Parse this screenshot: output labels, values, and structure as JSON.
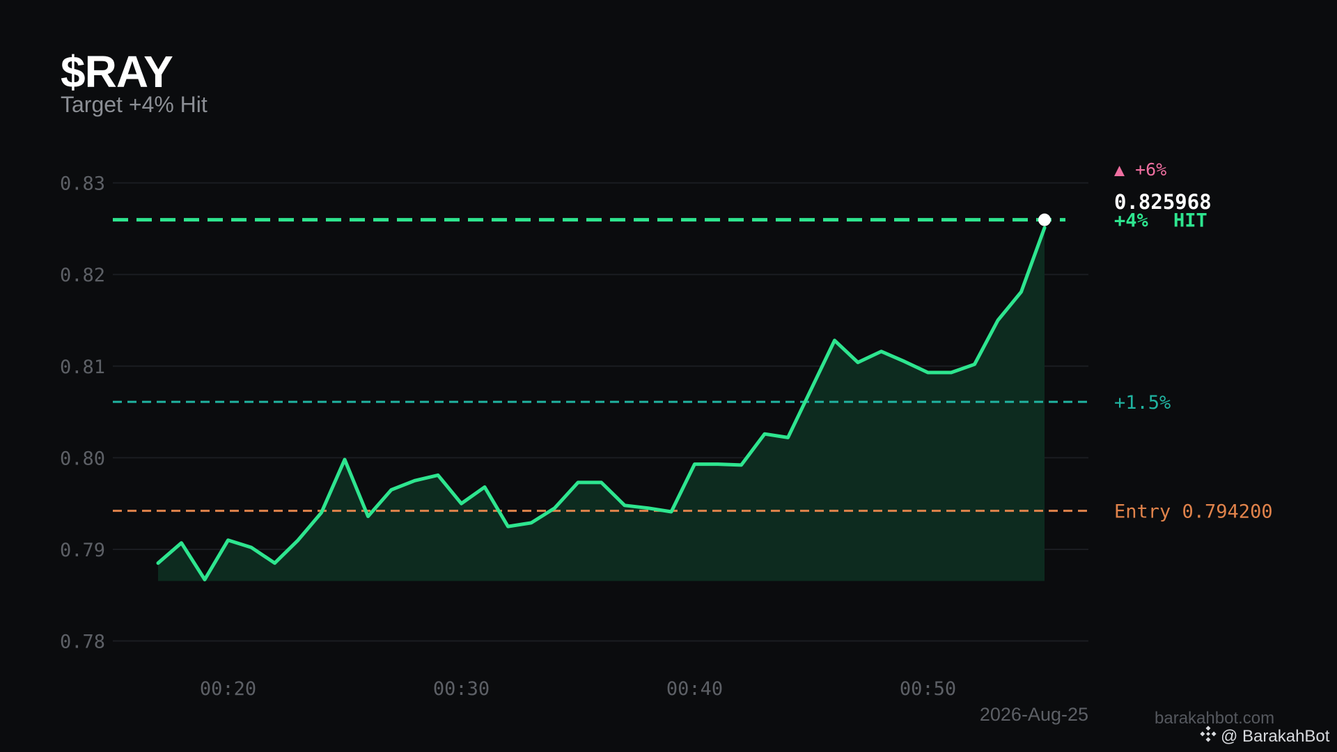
{
  "header": {
    "ticker": "$RAY",
    "subtitle": "Target +4% Hit"
  },
  "footer": {
    "date": "2026-Aug-25",
    "site": "barakahbot.com",
    "handle": "@ BarakahBot"
  },
  "colors": {
    "background": "#0b0c0e",
    "price_line": "#2ee58f",
    "area_fill": "#0d2b1f",
    "target_hit": "#2ee58f",
    "level_1_5": "#20b3a0",
    "entry": "#e0834b",
    "level_6": "#ef6fa0",
    "grid": "#1b1d21",
    "tick_text": "#5d6066"
  },
  "chart_data": {
    "type": "area",
    "ylim": [
      0.777,
      0.834
    ],
    "y_ticks": [
      0.78,
      0.79,
      0.8,
      0.81,
      0.82,
      0.83
    ],
    "y_tick_labels": [
      "0.78",
      "0.79",
      "0.80",
      "0.81",
      "0.82",
      "0.83"
    ],
    "x_ticks": [
      "00:20",
      "00:30",
      "00:40",
      "00:50"
    ],
    "x": [
      "00:17",
      "00:18",
      "00:19",
      "00:20",
      "00:21",
      "00:22",
      "00:23",
      "00:24",
      "00:25",
      "00:26",
      "00:27",
      "00:28",
      "00:29",
      "00:30",
      "00:31",
      "00:32",
      "00:33",
      "00:34",
      "00:35",
      "00:36",
      "00:37",
      "00:38",
      "00:39",
      "00:40",
      "00:41",
      "00:42",
      "00:43",
      "00:44",
      "00:45",
      "00:46",
      "00:47",
      "00:48",
      "00:49",
      "00:50",
      "00:51",
      "00:52",
      "00:53",
      "00:54",
      "00:55"
    ],
    "series": [
      {
        "values": [
          0.7885,
          0.7907,
          0.7867,
          0.791,
          0.7902,
          0.7885,
          0.791,
          0.794,
          0.7998,
          0.7936,
          0.7965,
          0.7975,
          0.7981,
          0.795,
          0.7968,
          0.7925,
          0.7929,
          0.7945,
          0.7973,
          0.7973,
          0.7948,
          0.7945,
          0.7941,
          0.7993,
          0.7993,
          0.7992,
          0.8026,
          0.8022,
          0.8075,
          0.8128,
          0.8104,
          0.8116,
          0.8105,
          0.8093,
          0.8093,
          0.8102,
          0.815,
          0.8181,
          0.8251
        ]
      }
    ],
    "current_price": "0.825968",
    "levels": [
      {
        "key": "target",
        "label": "+4%",
        "status": "HIT",
        "value": 0.825968
      },
      {
        "key": "plus_1_5",
        "label": "+1.5%",
        "value": 0.8061
      },
      {
        "key": "entry",
        "label": "Entry 0.794200",
        "value": 0.7942
      },
      {
        "key": "plus_6",
        "label": "▲ +6%"
      }
    ],
    "date_label": "2026-Aug-25",
    "grid": true
  }
}
